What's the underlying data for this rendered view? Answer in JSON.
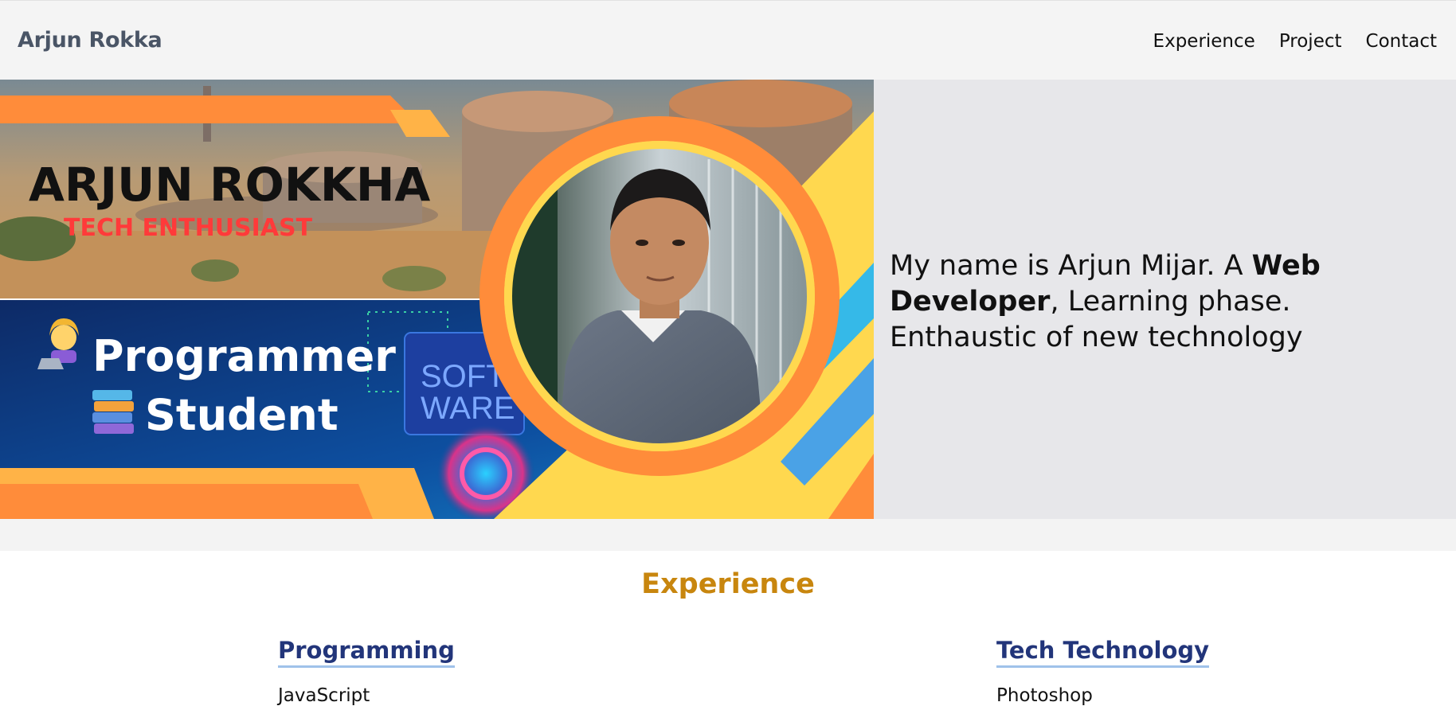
{
  "navbar": {
    "brand": "Arjun Rokka",
    "links": [
      "Experience",
      "Project",
      "Contact"
    ]
  },
  "hero": {
    "banner": {
      "name": "ARJUN ROKKHA",
      "tagline": "TECH ENTHUSIAST",
      "line1": "Programmer",
      "line2": "Student",
      "screen_text_1": "SOFT",
      "screen_text_2": "WARE"
    },
    "intro_prefix": "My name is Arjun Mijar. A ",
    "intro_bold": "Web Developer",
    "intro_suffix": ", Learning phase. Enthaustic of new technology"
  },
  "experience": {
    "title": "Experience",
    "columns": [
      {
        "heading": "Programming",
        "first_item": "JavaScript"
      },
      {
        "heading": "Tech Technology",
        "first_item": "Photoshop"
      }
    ]
  },
  "colors": {
    "accent_orange": "#ff8c3a",
    "accent_yellow": "#ffd84f",
    "title_gold": "#c8860e",
    "heading_navy": "#22357a"
  }
}
